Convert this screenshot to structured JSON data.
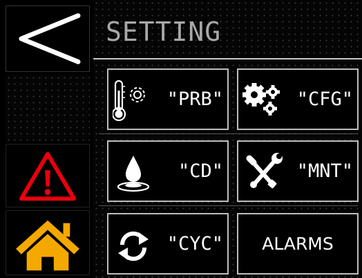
{
  "page": {
    "title": "SETTING"
  },
  "sidebar": {
    "back_icon": "chevron-left-icon",
    "alarm_icon": "warning-icon",
    "home_icon": "home-icon",
    "colors": {
      "alarm": "#e8000d",
      "home": "#f5a800"
    }
  },
  "tiles": [
    {
      "id": "prb",
      "label": "\"PRB\"",
      "icon": "thermometer-gear-icon"
    },
    {
      "id": "cfg",
      "label": "\"CFG\"",
      "icon": "gears-icon"
    },
    {
      "id": "cd",
      "label": "\"CD\"",
      "icon": "water-drop-icon"
    },
    {
      "id": "mnt",
      "label": "\"MNT\"",
      "icon": "tools-icon"
    },
    {
      "id": "cyc",
      "label": "\"CYC\"",
      "icon": "sync-icon"
    },
    {
      "id": "alarms",
      "label": "ALARMS",
      "icon": ""
    }
  ]
}
